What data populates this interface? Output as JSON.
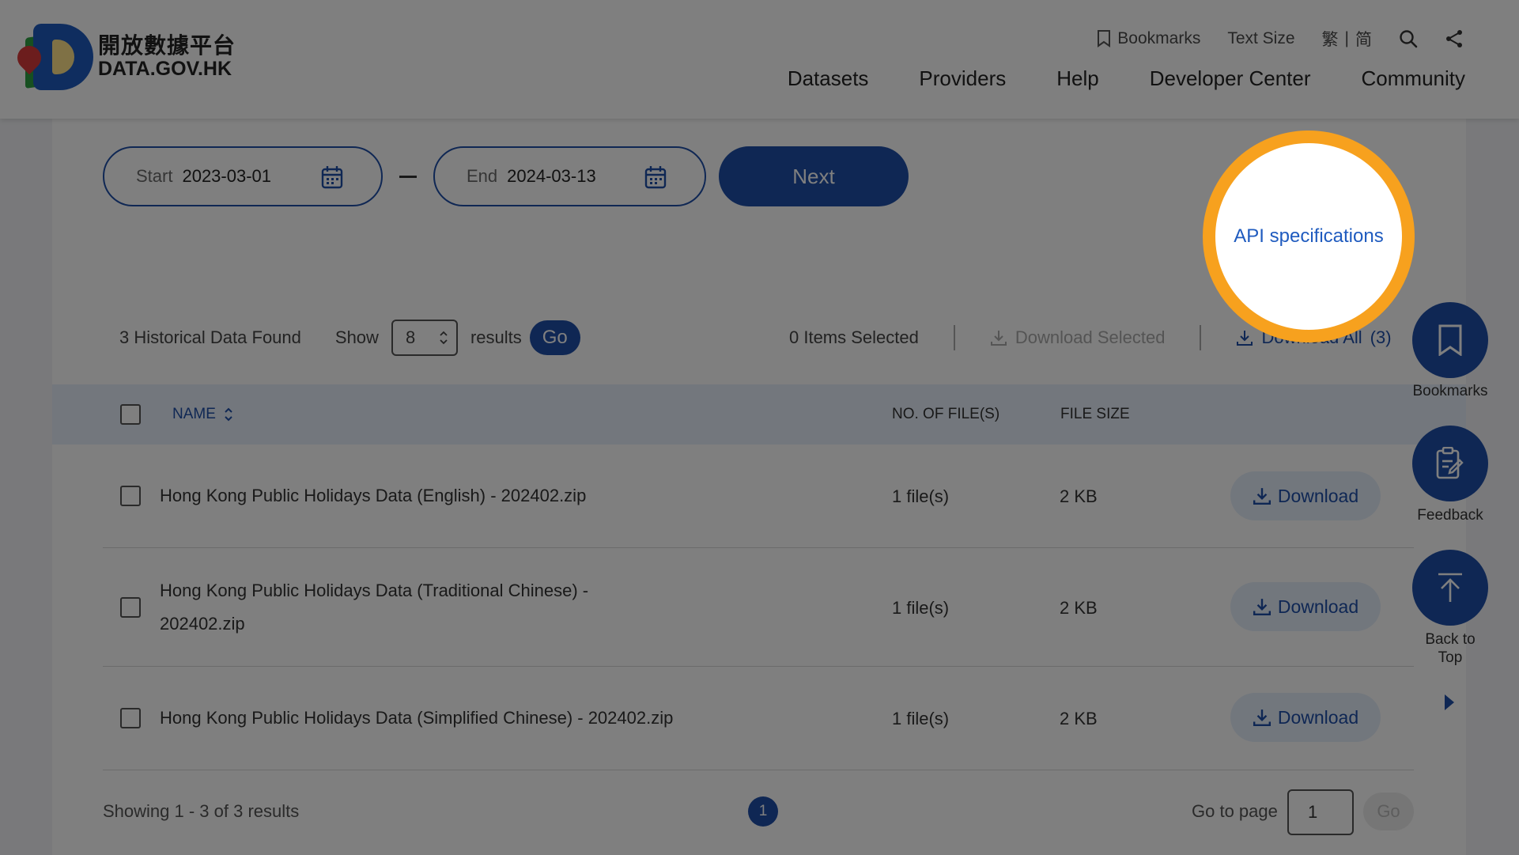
{
  "header": {
    "logo_cn": "開放數據平台",
    "logo_en": "DATA.GOV.HK",
    "utility": {
      "bookmarks": "Bookmarks",
      "text_size": "Text Size",
      "lang_trad": "繁",
      "lang_sep": "|",
      "lang_simp": "简"
    },
    "nav": [
      "Datasets",
      "Providers",
      "Help",
      "Developer Center",
      "Community"
    ]
  },
  "date_filter": {
    "start_label": "Start",
    "start_value": "2023-03-01",
    "end_label": "End",
    "end_value": "2024-03-13",
    "next_label": "Next"
  },
  "results_bar": {
    "found_text": "3 Historical Data Found",
    "show_label": "Show",
    "show_value": "8",
    "results_label": "results",
    "go_label": "Go",
    "selected_text": "0 Items Selected",
    "download_selected": "Download Selected",
    "download_all": "Download All",
    "download_all_count": "(3)"
  },
  "table": {
    "headers": {
      "name": "NAME",
      "files": "NO. OF FILE(S)",
      "size": "FILE SIZE"
    },
    "rows": [
      {
        "name": "Hong Kong Public Holidays Data (English) - 202402.zip",
        "files": "1 file(s)",
        "size": "2 KB",
        "action": "Download"
      },
      {
        "name_line1": "Hong Kong Public Holidays Data (Traditional Chinese) -",
        "name_line2": "202402.zip",
        "files": "1 file(s)",
        "size": "2 KB",
        "action": "Download"
      },
      {
        "name": "Hong Kong Public Holidays Data (Simplified Chinese) - 202402.zip",
        "files": "1 file(s)",
        "size": "2 KB",
        "action": "Download"
      }
    ]
  },
  "pagination": {
    "showing_text": "Showing 1 - 3 of 3 results",
    "current_page": "1",
    "goto_label": "Go to page",
    "goto_value": "1",
    "go_label": "Go"
  },
  "side_tools": {
    "bookmarks": "Bookmarks",
    "feedback": "Feedback",
    "back_to_top_1": "Back to",
    "back_to_top_2": "Top"
  },
  "spotlight": {
    "link": "API specifications"
  },
  "colors": {
    "primary": "#1f4fa8",
    "highlight_ring": "#f7a11e",
    "link": "#1f5bbf"
  }
}
